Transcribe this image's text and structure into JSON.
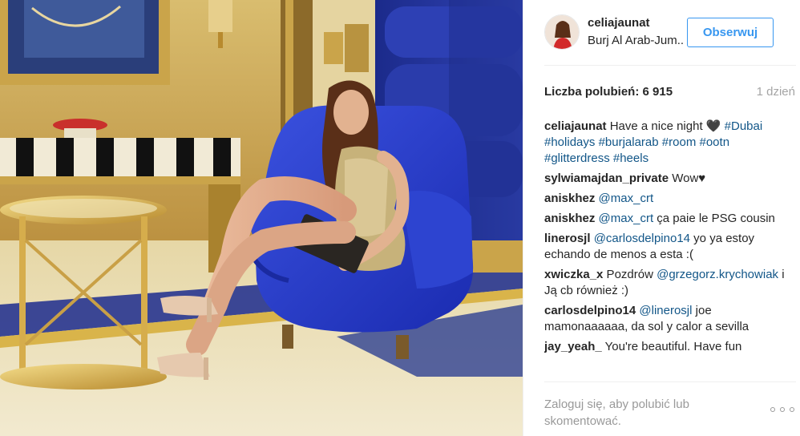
{
  "header": {
    "username": "celiajaunat",
    "location": "Burj Al Arab-Jum...",
    "follow_label": "Obserwuj"
  },
  "stats": {
    "likes": "Liczba polubień: 6 915",
    "time": "1 dzień"
  },
  "comments": [
    {
      "author": "celiajaunat",
      "parts": [
        {
          "t": "text",
          "v": " Have a nice night 🖤 "
        },
        {
          "t": "tag",
          "v": "#Dubai"
        },
        {
          "t": "text",
          "v": " "
        },
        {
          "t": "tag",
          "v": "#holidays"
        },
        {
          "t": "text",
          "v": " "
        },
        {
          "t": "tag",
          "v": "#burjalarab"
        },
        {
          "t": "text",
          "v": " "
        },
        {
          "t": "tag",
          "v": "#room"
        },
        {
          "t": "text",
          "v": " "
        },
        {
          "t": "tag",
          "v": "#ootn"
        },
        {
          "t": "text",
          "v": " "
        },
        {
          "t": "tag",
          "v": "#glitterdress"
        },
        {
          "t": "text",
          "v": " "
        },
        {
          "t": "tag",
          "v": "#heels"
        }
      ]
    },
    {
      "author": "sylwiamajdan_private",
      "parts": [
        {
          "t": "text",
          "v": " Wow♥"
        }
      ]
    },
    {
      "author": "aniskhez",
      "parts": [
        {
          "t": "text",
          "v": " "
        },
        {
          "t": "tag",
          "v": "@max_crt"
        }
      ]
    },
    {
      "author": "aniskhez",
      "parts": [
        {
          "t": "text",
          "v": " "
        },
        {
          "t": "tag",
          "v": "@max_crt"
        },
        {
          "t": "text",
          "v": " ça paie le PSG cousin"
        }
      ]
    },
    {
      "author": "linerosjl",
      "parts": [
        {
          "t": "text",
          "v": " "
        },
        {
          "t": "tag",
          "v": "@carlosdelpino14"
        },
        {
          "t": "text",
          "v": " yo ya estoy echando de menos a esta :("
        }
      ]
    },
    {
      "author": "xwiczka_x",
      "parts": [
        {
          "t": "text",
          "v": " Pozdrów "
        },
        {
          "t": "tag",
          "v": "@grzegorz.krychowiak"
        },
        {
          "t": "text",
          "v": " i Ją cb również :)"
        }
      ]
    },
    {
      "author": "carlosdelpino14",
      "parts": [
        {
          "t": "text",
          "v": " "
        },
        {
          "t": "tag",
          "v": "@linerosjl"
        },
        {
          "t": "text",
          "v": " joe mamonaaaaaa, da sol y calor a sevilla"
        }
      ]
    },
    {
      "author": "jay_yeah_",
      "parts": [
        {
          "t": "text",
          "v": " You're beautiful. Have fun"
        }
      ]
    }
  ],
  "footer": {
    "login_prompt": "Zaloguj się, aby polubić lub skomentować."
  },
  "icons": {
    "more": "more-options-icon"
  },
  "colors": {
    "accent": "#3897f0",
    "tag": "#125688",
    "muted": "#a5a5a5"
  }
}
